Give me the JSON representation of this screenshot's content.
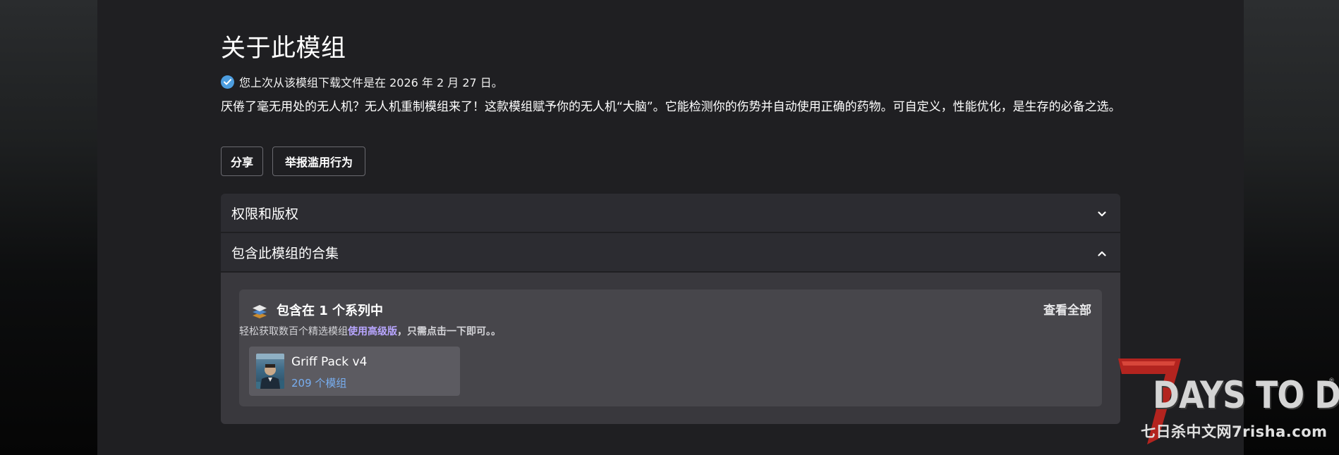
{
  "title": "关于此模组",
  "download_note": "您上次从该模组下载文件是在 2026 年 2 月 27 日。",
  "description": "厌倦了毫无用处的无人机？无人机重制模组来了！这款模组赋予你的无人机“大脑”。它能检测你的伤势并自动使用正确的药物。可自定义，性能优化，是生存的必备之选。",
  "buttons": {
    "share": "分享",
    "report": "举报滥用行为"
  },
  "accordion": {
    "permissions": "权限和版权",
    "collections": "包含此模组的合集"
  },
  "collections": {
    "heading": "包含在 1 个系列中",
    "view_all": "查看全部",
    "subtitle_prefix": "轻松获取数百个精选模组",
    "subtitle_link": "使用高级版",
    "subtitle_suffix": "，只需点击一下即可。。",
    "items": [
      {
        "name": "Griff Pack v4",
        "count": "209 个模组"
      }
    ]
  },
  "watermark": {
    "seven": "7",
    "logo_text": "DAYS TO DIE",
    "registered": "®",
    "site": "七日杀中文网7risha.com"
  },
  "colors": {
    "panel": "#1f1f22",
    "accordion": "#2c2c31",
    "card": "#47464b",
    "link_blue": "#78aef0",
    "promo_purple": "#b8a6ff",
    "check_blue": "#4d9ee0",
    "logo_red": "#b3241f"
  }
}
